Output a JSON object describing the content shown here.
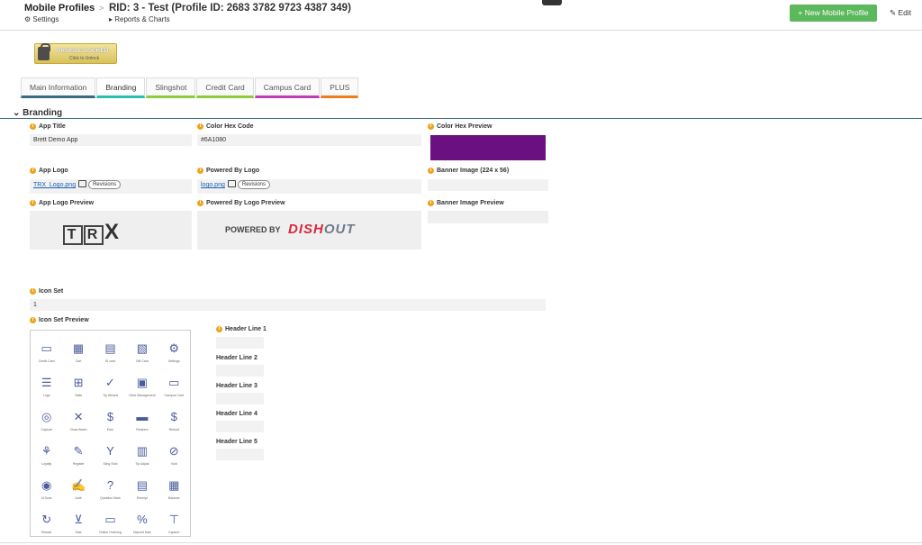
{
  "header": {
    "app_title": "Mobile Profiles",
    "breadcrumb_sep": ">",
    "record_title": "RID: 3 - Test (Profile ID: 2683 3782 9723 4387 349)",
    "settings_label": "Settings",
    "reports_label": "Reports & Charts",
    "new_button_label": "+ New Mobile Profile",
    "edit_label": "Edit"
  },
  "lock": {
    "label": "PROFILE LOCKED",
    "sub": "Click to Unlock"
  },
  "tabs": [
    {
      "label": "Main Information",
      "color": "#3b6a84"
    },
    {
      "label": "Branding",
      "color": "#2bbfb0"
    },
    {
      "label": "Slingshot",
      "color": "#8ccc3a"
    },
    {
      "label": "Credit Card",
      "color": "#8ccc3a"
    },
    {
      "label": "Campus Card",
      "color": "#c03bb8"
    },
    {
      "label": "PLUS",
      "color": "#f07c1a"
    }
  ],
  "section": {
    "title": "Branding"
  },
  "fields": {
    "app_title": {
      "label": "App Title",
      "value": "Brett Demo App"
    },
    "color_hex": {
      "label": "Color Hex Code",
      "value": "#6A1080"
    },
    "color_preview": {
      "label": "Color Hex Preview",
      "color": "#6a1080"
    },
    "app_logo": {
      "label": "App Logo",
      "file": "TRX_Logo.png",
      "rev": "Revisions"
    },
    "powered_logo": {
      "label": "Powered By Logo",
      "file": "logo.png",
      "rev": "Revisions"
    },
    "banner_image": {
      "label": "Banner Image (224 x 56)"
    },
    "app_logo_preview": {
      "label": "App Logo Preview",
      "logo_letters": [
        "T",
        "R",
        "X"
      ]
    },
    "powered_preview": {
      "label": "Powered By Logo Preview",
      "prefix": "POWERED BY",
      "brand1": "DISH",
      "brand2": "OUT"
    },
    "banner_preview": {
      "label": "Banner Image Preview"
    },
    "icon_set": {
      "label": "Icon Set",
      "value": "1"
    },
    "icon_set_preview": {
      "label": "Icon Set Preview"
    },
    "header_lines": [
      {
        "label": "Header Line 1"
      },
      {
        "label": "Header Line 2"
      },
      {
        "label": "Header Line 3"
      },
      {
        "label": "Header Line 4"
      },
      {
        "label": "Header Line 5"
      }
    ]
  },
  "icons": [
    {
      "name": "Credit Card",
      "glyph": "▭"
    },
    {
      "name": "Cart",
      "glyph": "▦"
    },
    {
      "name": "ID card",
      "glyph": "▤"
    },
    {
      "name": "Gift Card",
      "glyph": "▧"
    },
    {
      "name": "Settings",
      "glyph": "⚙"
    },
    {
      "name": "Logs",
      "glyph": "☰"
    },
    {
      "name": "Table",
      "glyph": "⊞"
    },
    {
      "name": "Tip Wizard",
      "glyph": "✓"
    },
    {
      "name": "Clerk Management",
      "glyph": "▣"
    },
    {
      "name": "Campus Card",
      "glyph": "▭"
    },
    {
      "name": "Capture",
      "glyph": "◎"
    },
    {
      "name": "Close Batch",
      "glyph": "✕"
    },
    {
      "name": "Earn",
      "glyph": "$"
    },
    {
      "name": "Redeem",
      "glyph": "▬"
    },
    {
      "name": "Refund",
      "glyph": "$"
    },
    {
      "name": "Loyalty",
      "glyph": "⚘"
    },
    {
      "name": "Register",
      "glyph": "✎"
    },
    {
      "name": "Sling Shot",
      "glyph": "Y"
    },
    {
      "name": "Tip Adjust",
      "glyph": "▥"
    },
    {
      "name": "Void",
      "glyph": "⊘"
    },
    {
      "name": "Id Scan",
      "glyph": "◉"
    },
    {
      "name": "Auth",
      "glyph": "✍"
    },
    {
      "name": "Question Mark",
      "glyph": "?"
    },
    {
      "name": "Receipt",
      "glyph": "▤"
    },
    {
      "name": "Balance",
      "glyph": "▦"
    },
    {
      "name": "Reload",
      "glyph": "↻"
    },
    {
      "name": "Sale",
      "glyph": "⊻"
    },
    {
      "name": "Online Ordering",
      "glyph": "▭"
    },
    {
      "name": "Deposit Sale",
      "glyph": "%"
    },
    {
      "name": "Capture",
      "glyph": "⊤"
    }
  ]
}
